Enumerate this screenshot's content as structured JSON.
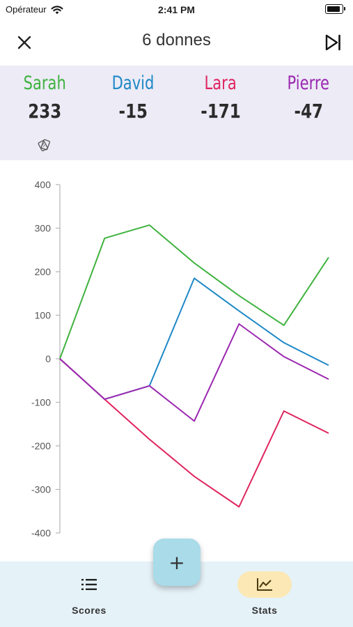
{
  "status_bar": {
    "carrier": "Opérateur",
    "time": "2:41 PM"
  },
  "header": {
    "title": "6 donnes"
  },
  "players": [
    {
      "name": "Sarah",
      "score": "233",
      "color": "#3fb23f"
    },
    {
      "name": "David",
      "score": "-15",
      "color": "#1e88c7"
    },
    {
      "name": "Lara",
      "score": "-171",
      "color": "#e0245e"
    },
    {
      "name": "Pierre",
      "score": "-47",
      "color": "#9b27b0"
    }
  ],
  "chart_data": {
    "type": "line",
    "x": [
      0,
      1,
      2,
      3,
      4,
      5,
      6
    ],
    "ylim": [
      -400,
      400
    ],
    "yticks": [
      400,
      300,
      200,
      100,
      0,
      -100,
      -200,
      -300,
      -400
    ],
    "ytick_labels": [
      "400",
      "300",
      "200",
      "100",
      "0",
      "-100",
      "-200",
      "-300",
      "-400"
    ],
    "series": [
      {
        "name": "Sarah",
        "color": "#3fb23f",
        "values": [
          0,
          277,
          307,
          220,
          145,
          77,
          233
        ]
      },
      {
        "name": "David",
        "color": "#1e88c7",
        "values": [
          0,
          -93,
          -62,
          185,
          110,
          37,
          -15
        ]
      },
      {
        "name": "Lara",
        "color": "#e0245e",
        "values": [
          0,
          -93,
          -185,
          -270,
          -340,
          -120,
          -171
        ]
      },
      {
        "name": "Pierre",
        "color": "#9b27b0",
        "values": [
          0,
          -93,
          -62,
          -143,
          80,
          5,
          -47
        ]
      }
    ]
  },
  "tabs": [
    {
      "label": "Scores",
      "icon": "list-icon",
      "active": false
    },
    {
      "label": "Stats",
      "icon": "line-chart-icon",
      "active": true,
      "active_bg": "#fbe8b4"
    }
  ],
  "fab": {
    "label": "+"
  }
}
